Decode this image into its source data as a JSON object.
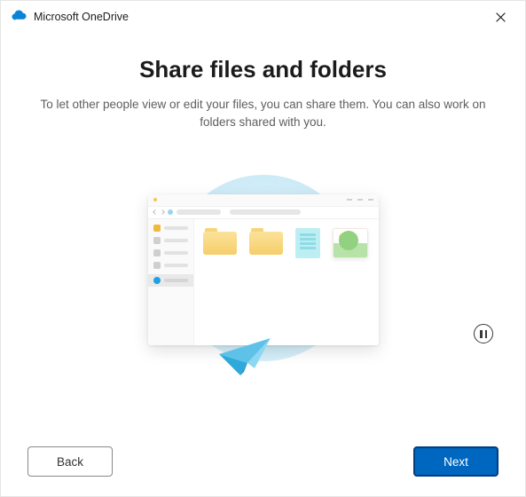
{
  "titlebar": {
    "app_name": "Microsoft OneDrive"
  },
  "content": {
    "heading": "Share files and folders",
    "subheading": "To let other people view or edit your files, you can share them. You can also work on folders shared with you."
  },
  "controls": {
    "pause_icon": "pause"
  },
  "footer": {
    "back_label": "Back",
    "next_label": "Next"
  },
  "icons": {
    "onedrive": "cloud",
    "close": "close"
  }
}
